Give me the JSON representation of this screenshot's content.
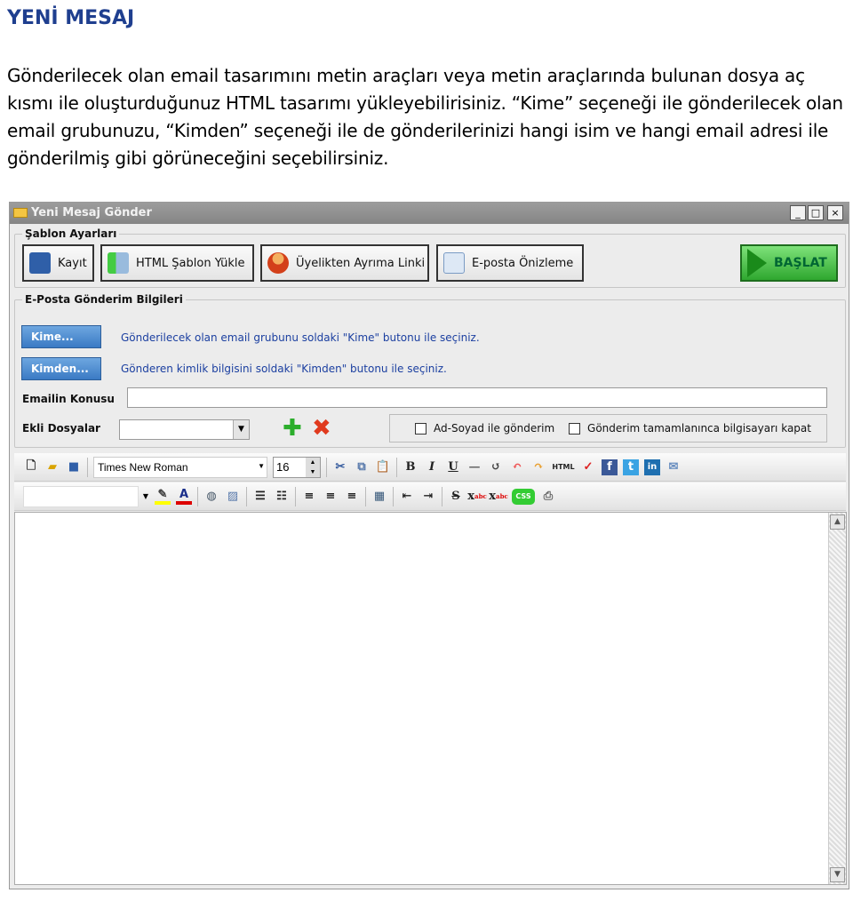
{
  "heading": "YENİ MESAJ",
  "intro": "Gönderilecek olan email tasarımını metin araçları veya metin araçlarında bulunan dosya aç kısmı ile oluşturduğunuz HTML tasarımı yükleyebilirisiniz. “Kime” seçeneği ile gönderilecek olan email grubunuzu, “Kimden” seçeneği ile de gönderilerinizi hangi isim ve hangi email adresi ile gönderilmiş gibi görüneceğini seçebilirsiniz.",
  "window": {
    "title": "Yeni Mesaj Gönder",
    "minimize": "_",
    "maximize": "□",
    "close": "×"
  },
  "template_group": {
    "legend": "Şablon Ayarları",
    "save": "Kayıt",
    "load_html": "HTML Şablon Yükle",
    "unsubscribe_link": "Üyelikten Ayrıma Linki",
    "preview": "E-posta Önizleme",
    "start": "BAŞLAT"
  },
  "send_group": {
    "legend": "E-Posta Gönderim Bilgileri",
    "to_button": "Kime...",
    "to_hint": "Gönderilecek olan email grubunu soldaki \"Kime\" butonu ile seçiniz.",
    "from_button": "Kimden...",
    "from_hint": "Gönderen kimlik bilgisini soldaki \"Kimden\" butonu ile seçiniz.",
    "subject_label": "Emailin Konusu",
    "subject_value": "",
    "attachments_label": "Ekli Dosyalar",
    "attachments_value": "",
    "send_with_name": "Ad-Soyad ile gönderim",
    "shutdown_on_complete": "Gönderim tamamlanınca bilgisayarı kapat"
  },
  "editor": {
    "font": "Times New Roman",
    "size": "16",
    "style_value": "",
    "html_icon": "HTML",
    "css_icon": "CSS",
    "bold": "B",
    "italic": "I",
    "underline": "U"
  },
  "colors": {
    "heading": "#1f3f8f",
    "hint": "#1b3fa0",
    "start": "#2fa72f",
    "blue_button": "#3a7ac4"
  }
}
